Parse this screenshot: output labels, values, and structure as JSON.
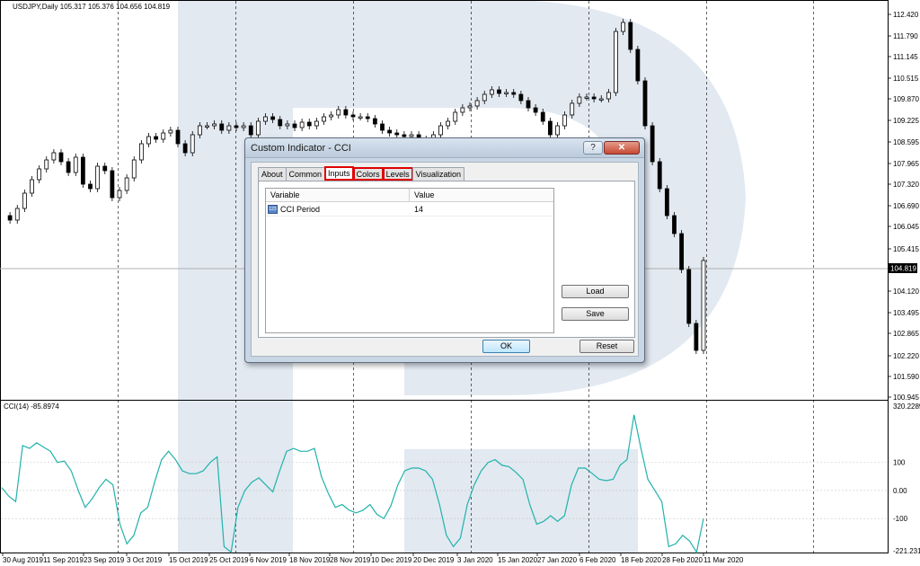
{
  "chart": {
    "header": "USDJPY,Daily  105.317 105.376 104.656 104.819",
    "current_price_label": "104.819",
    "price_axis": [
      "112.420",
      "111.790",
      "111.145",
      "110.515",
      "109.870",
      "109.225",
      "108.595",
      "107.965",
      "107.320",
      "106.690",
      "106.045",
      "105.415",
      "104.819",
      "104.120",
      "103.495",
      "102.865",
      "102.220",
      "101.590",
      "100.945"
    ],
    "date_axis": [
      "30 Aug 2019",
      "11 Sep 2019",
      "23 Sep 2019",
      "3 Oct 2019",
      "15 Oct 2019",
      "25 Oct 2019",
      "6 Nov 2019",
      "18 Nov 2019",
      "28 Nov 2019",
      "10 Dec 2019",
      "20 Dec 2019",
      "3 Jan 2020",
      "15 Jan 2020",
      "27 Jan 2020",
      "6 Feb 2020",
      "18 Feb 2020",
      "28 Feb 2020",
      "11 Mar 2020"
    ],
    "colors": {
      "candle": "#000000",
      "cci_line": "#20b2aa",
      "grid": "#000000",
      "watermark": "#dfe6ee"
    }
  },
  "cci": {
    "header": "CCI(14) -85.8974",
    "axis": [
      "320.2289",
      "100",
      "0.00",
      "-100",
      "-221.2313"
    ]
  },
  "chart_data": {
    "type": "line",
    "title": "CCI(14) -85.8974",
    "xlabel": "",
    "ylabel": "",
    "ylim": [
      -221.2313,
      320.2289
    ],
    "series": [
      {
        "name": "CCI(14)",
        "values": [
          10,
          -20,
          -40,
          160,
          150,
          170,
          155,
          140,
          100,
          105,
          70,
          0,
          -60,
          -30,
          10,
          40,
          20,
          -120,
          -190,
          -160,
          -80,
          -60,
          30,
          110,
          140,
          110,
          70,
          60,
          60,
          70,
          100,
          120,
          -200,
          -220,
          -60,
          0,
          30,
          45,
          20,
          -5,
          70,
          140,
          150,
          140,
          140,
          150,
          50,
          -10,
          -60,
          -50,
          -70,
          -80,
          -70,
          -50,
          -85,
          -100,
          -55,
          20,
          70,
          80,
          80,
          70,
          40,
          -50,
          -160,
          -200,
          -170,
          -50,
          20,
          70,
          100,
          110,
          90,
          85,
          65,
          40,
          -50,
          -120,
          -110,
          -90,
          -110,
          -90,
          20,
          80,
          80,
          60,
          40,
          35,
          40,
          90,
          110,
          270,
          150,
          40,
          0,
          -40,
          -200,
          -190,
          -160,
          -180,
          -220,
          -100
        ]
      }
    ]
  },
  "dialog": {
    "title": "Custom Indicator - CCI",
    "help_glyph": "?",
    "close_glyph": "✕",
    "tabs": [
      "About",
      "Common",
      "Inputs",
      "Colors",
      "Levels",
      "Visualization"
    ],
    "table": {
      "columns": [
        "Variable",
        "Value"
      ],
      "rows": [
        {
          "icon": "123",
          "variable": "CCI Period",
          "value": "14"
        }
      ]
    },
    "buttons": {
      "load": "Load",
      "save": "Save",
      "ok": "OK",
      "reset": "Reset"
    }
  }
}
